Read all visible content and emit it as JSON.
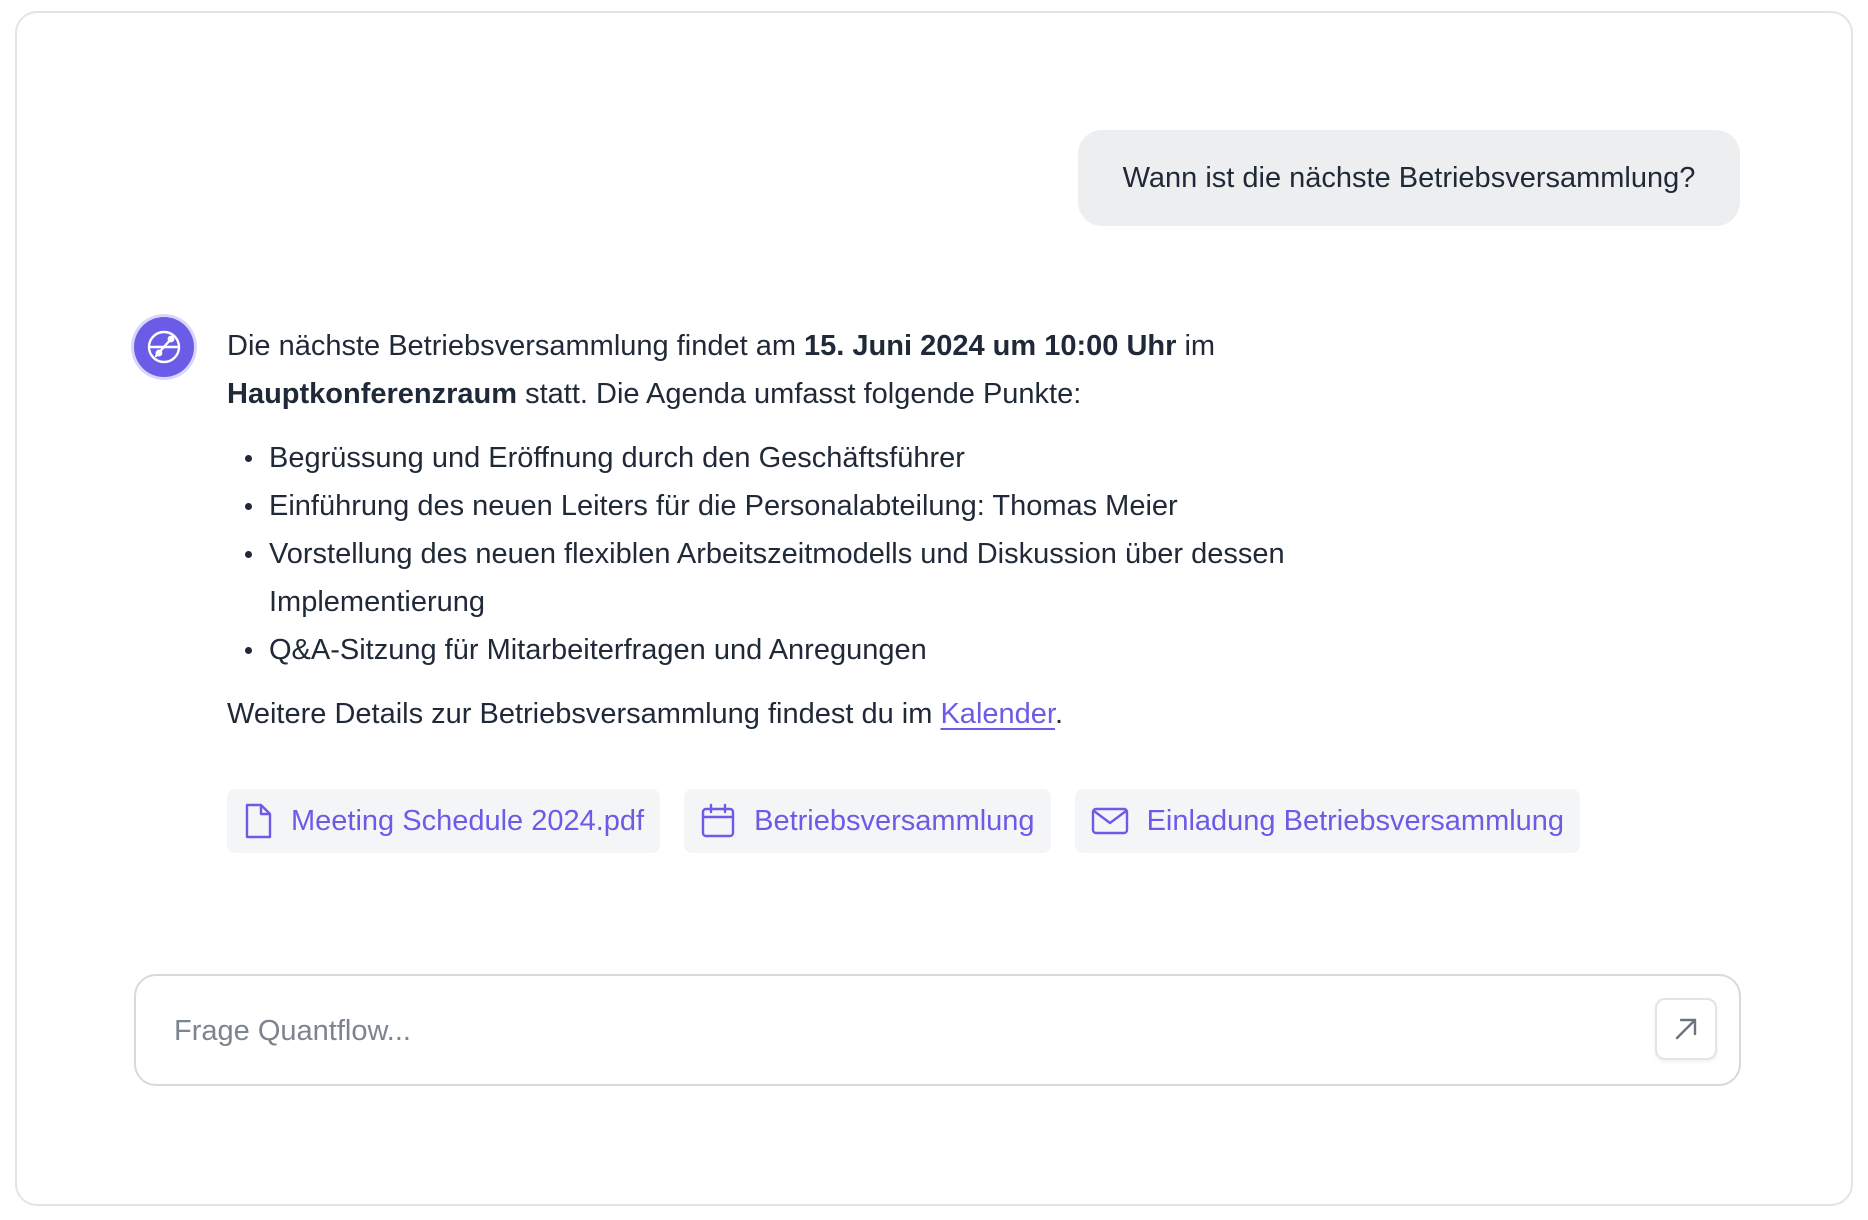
{
  "conversation": {
    "user_message": "Wann ist die nächste Betriebsversammlung?",
    "assistant": {
      "avatar_icon": "quantflow-logo-icon",
      "intro_1": "Die nächste Betriebsversammlung findet am ",
      "date_time": "15. Juni 2024 um 10:00 Uhr",
      "intro_2": " im ",
      "room": "Hauptkonferenzraum",
      "intro_3": " statt. Die Agenda umfasst folgende Punkte:",
      "agenda": [
        "Begrüssung und Eröffnung durch den Geschäftsführer",
        "Einführung des neuen Leiters für die Personalabteilung: Thomas Meier",
        "Vorstellung des neuen flexiblen Arbeitszeitmodells und Diskussion über dessen Implementierung",
        "Q&A-Sitzung für Mitarbeiterfragen und Anregungen"
      ],
      "outro_1": "Weitere Details zur Betriebsversammlung findest du im ",
      "link_label": "Kalender",
      "outro_2": "."
    },
    "sources": [
      {
        "label": "Meeting Schedule 2024.pdf",
        "icon": "file-icon"
      },
      {
        "label": "Betriebsversammlung",
        "icon": "calendar-icon"
      },
      {
        "label": "Einladung Betriebsversammlung",
        "icon": "mail-icon"
      }
    ]
  },
  "composer": {
    "placeholder": "Frage Quantflow...",
    "value": "",
    "send_icon": "arrow-up-right-icon"
  },
  "colors": {
    "accent": "#6b5ce7",
    "user_bubble": "#eceef0",
    "chip_bg": "#f4f5f7",
    "text": "#1f2937",
    "placeholder": "#7b8490"
  }
}
